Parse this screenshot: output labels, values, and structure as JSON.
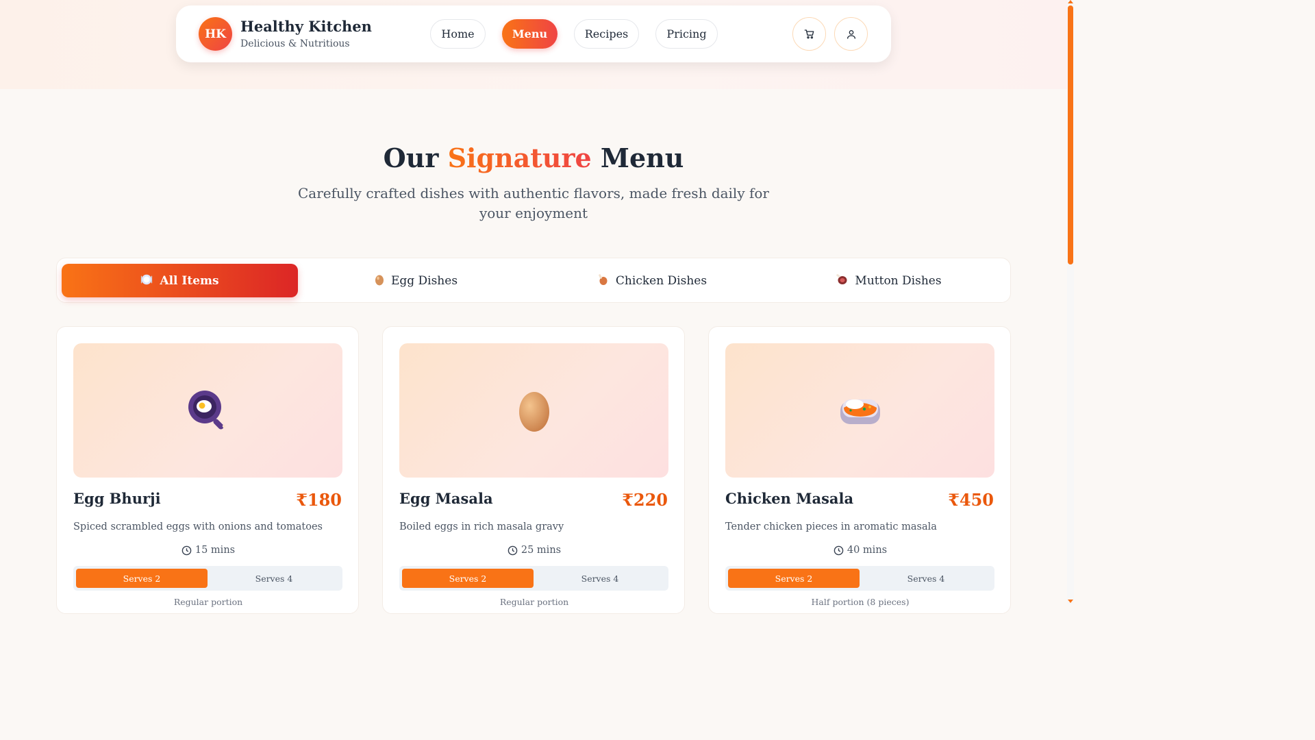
{
  "brand": {
    "initials": "HK",
    "title": "Healthy Kitchen",
    "subtitle": "Delicious & Nutritious"
  },
  "nav": {
    "items": [
      {
        "label": "Home",
        "active": false
      },
      {
        "label": "Menu",
        "active": true
      },
      {
        "label": "Recipes",
        "active": false
      },
      {
        "label": "Pricing",
        "active": false
      }
    ],
    "icons": [
      "cart-icon",
      "user-icon"
    ]
  },
  "hero": {
    "title_pre": "Our",
    "title_accent": "Signature",
    "title_post": "Menu",
    "subtitle": "Carefully crafted dishes with authentic flavors, made fresh daily for your enjoyment"
  },
  "tabs": [
    {
      "label": "All Items",
      "icon": "plate-icon",
      "active": true
    },
    {
      "label": "Egg Dishes",
      "icon": "egg-icon",
      "active": false
    },
    {
      "label": "Chicken Dishes",
      "icon": "drumstick-icon",
      "active": false
    },
    {
      "label": "Mutton Dishes",
      "icon": "meat-icon",
      "active": false
    }
  ],
  "cards": [
    {
      "name": "Egg Bhurji",
      "price": "₹180",
      "description": "Spiced scrambled eggs with onions and tomatoes",
      "time": "15 mins",
      "serves_options": [
        "Serves 2",
        "Serves 4"
      ],
      "selected_serves": "Serves 2",
      "portion": "Regular portion",
      "image_icon": "frying-pan-icon"
    },
    {
      "name": "Egg Masala",
      "price": "₹220",
      "description": "Boiled eggs in rich masala gravy",
      "time": "25 mins",
      "serves_options": [
        "Serves 2",
        "Serves 4"
      ],
      "selected_serves": "Serves 2",
      "portion": "Regular portion",
      "image_icon": "egg-icon"
    },
    {
      "name": "Chicken Masala",
      "price": "₹450",
      "description": "Tender chicken pieces in aromatic masala",
      "time": "40 mins",
      "serves_options": [
        "Serves 2",
        "Serves 4"
      ],
      "selected_serves": "Serves 2",
      "portion": "Half portion (8 pieces)",
      "image_icon": "curry-rice-icon"
    }
  ],
  "colors": {
    "accent": "#f97316",
    "accent_end": "#ef4444",
    "price": "#ea580c"
  }
}
